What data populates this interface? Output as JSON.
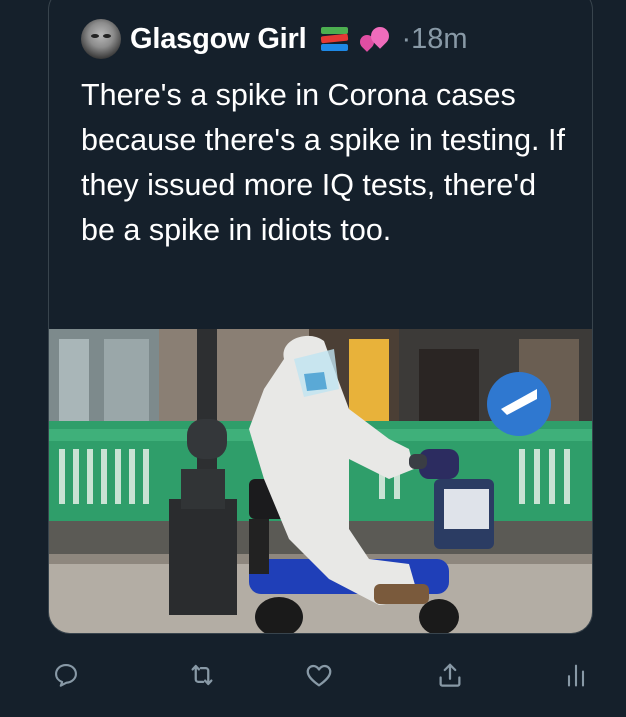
{
  "tweet": {
    "author_name": "Glasgow Girl",
    "timestamp": "·18m",
    "text": "There's a spike in Corona cases because there's a spike in testing. If they issued more IQ tests, there'd be a spike in idiots too.",
    "header_emojis": [
      "books-icon",
      "two-hearts-icon"
    ]
  },
  "actions": [
    {
      "name": "reply",
      "icon": "comment-icon"
    },
    {
      "name": "retweet",
      "icon": "retweet-icon"
    },
    {
      "name": "like",
      "icon": "heart-icon"
    },
    {
      "name": "share",
      "icon": "share-icon"
    },
    {
      "name": "analytics",
      "icon": "analytics-icon"
    }
  ],
  "colors": {
    "background": "#15202b",
    "text": "#ffffff",
    "secondary_text": "#8899a6",
    "border": "#38444d"
  }
}
